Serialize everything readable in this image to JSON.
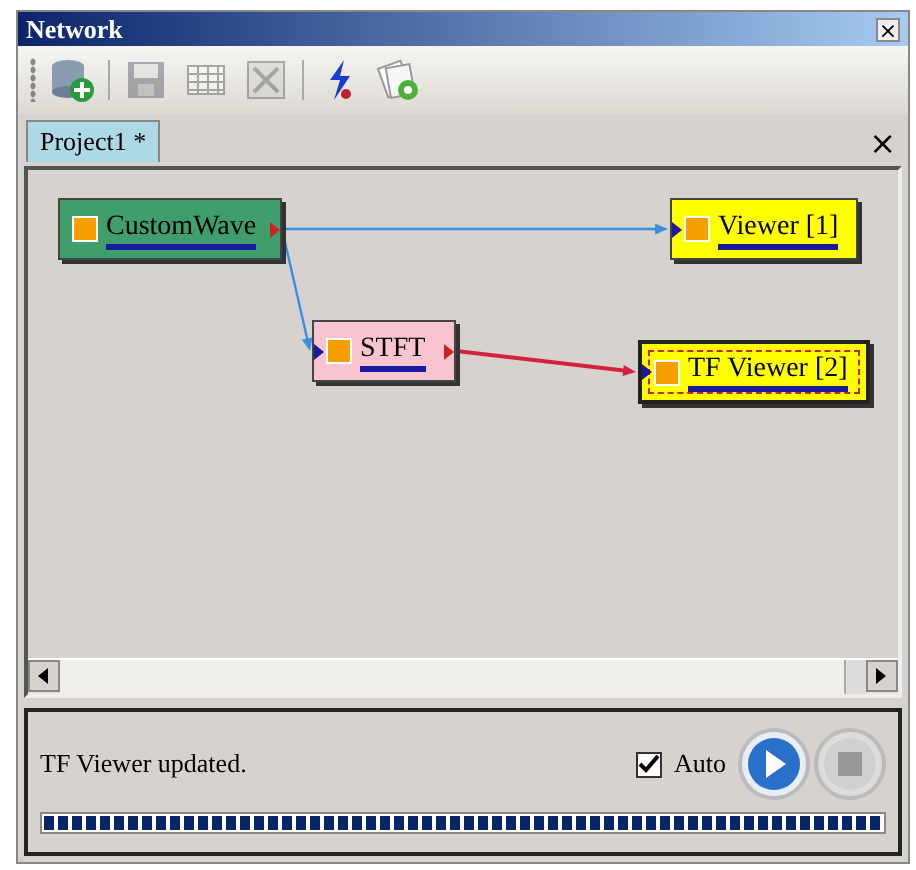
{
  "window": {
    "title": "Network",
    "close": "×"
  },
  "toolbar": [
    {
      "kind": "database-add",
      "disabled": false
    },
    {
      "kind": "save",
      "disabled": true
    },
    {
      "kind": "grid",
      "disabled": true
    },
    {
      "kind": "image-delete",
      "disabled": true
    },
    {
      "kind": "bolt",
      "disabled": false
    },
    {
      "kind": "pages-gear",
      "disabled": false
    }
  ],
  "tabs": [
    {
      "label": "Project1 *",
      "selected": true
    }
  ],
  "tab_close": "×",
  "nodes": [
    {
      "label": "CustomWave",
      "color": "#3f9e6c",
      "selected": false,
      "has_input": false,
      "has_output": true
    },
    {
      "label": "Viewer [1]",
      "color": "#ffff00",
      "selected": false,
      "has_input": true,
      "has_output": false
    },
    {
      "label": "STFT",
      "color": "#f9c3d0",
      "selected": false,
      "has_input": true,
      "has_output": true
    },
    {
      "label": "TF Viewer [2]",
      "color": "#ffff00",
      "selected": true,
      "has_input": true,
      "has_output": false
    }
  ],
  "edges": [
    {
      "color": "#3a8de0"
    },
    {
      "color": "#3a8de0"
    },
    {
      "color": "#d4213f"
    }
  ],
  "status": {
    "message": "TF Viewer updated.",
    "auto": {
      "label": "Auto",
      "checked": true
    },
    "buttons": [
      {
        "kind": "play",
        "disabled": false
      },
      {
        "kind": "stop",
        "disabled": true
      }
    ],
    "progress": {
      "level": 1
    }
  }
}
